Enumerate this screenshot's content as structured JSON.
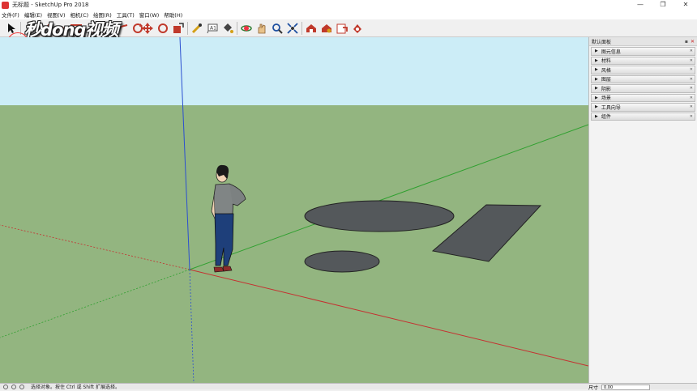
{
  "window": {
    "title": "无标题 - SketchUp Pro 2018",
    "controls": [
      "—",
      "❐",
      "✕"
    ]
  },
  "menu": [
    "文件(F)",
    "编辑(E)",
    "视图(V)",
    "相机(C)",
    "绘图(R)",
    "工具(T)",
    "窗口(W)",
    "帮助(H)"
  ],
  "toolbar": {
    "tools": [
      {
        "name": "select-tool-icon",
        "color": "#222222"
      },
      {
        "name": "eraser-tool-icon",
        "color": "#e85d8a"
      },
      {
        "name": "line-tool-icon",
        "color": "#c0392b"
      },
      {
        "name": "arc-tool-icon",
        "color": "#c0392b"
      },
      {
        "name": "rectangle-tool-icon",
        "color": "#c0392b"
      },
      {
        "name": "push-pull-tool-icon",
        "color": "#c0392b"
      },
      {
        "name": "move-tool-icon",
        "color": "#c0392b"
      },
      {
        "name": "rotate-tool-icon",
        "color": "#c0392b"
      },
      {
        "name": "scale-tool-icon",
        "color": "#c0392b"
      },
      {
        "name": "tape-measure-tool-icon",
        "color": "#d4a017"
      },
      {
        "name": "text-tool-icon",
        "color": "#555555"
      },
      {
        "name": "paint-bucket-tool-icon",
        "color": "#444444"
      },
      {
        "name": "orbit-tool-icon",
        "color": "#2e7d32"
      },
      {
        "name": "pan-tool-icon",
        "color": "#c48a3a"
      },
      {
        "name": "zoom-tool-icon",
        "color": "#1e4fa0"
      },
      {
        "name": "zoom-extents-tool-icon",
        "color": "#1e4fa0"
      },
      {
        "name": "warehouse-icon",
        "color": "#c0392b"
      },
      {
        "name": "extension-warehouse-icon",
        "color": "#c0392b"
      },
      {
        "name": "send-to-layout-icon",
        "color": "#c0392b"
      },
      {
        "name": "extension-manager-icon",
        "color": "#c0392b"
      }
    ]
  },
  "watermark": {
    "text": "秒dong视频"
  },
  "tray": {
    "title": "默认面板",
    "panels": [
      "图元信息",
      "材料",
      "风格",
      "图层",
      "阴影",
      "场景",
      "工具向导",
      "组件"
    ]
  },
  "status": {
    "hint": "选择对象。按住 Ctrl 或 Shift 扩展选择。",
    "measurement_label": "尺寸",
    "measurement_value": "0.00"
  },
  "colors": {
    "sky": "#ccedf7",
    "ground": "#93b580",
    "shape_fill": "#54585b",
    "red_axis": "#c53030",
    "green_axis": "#2fa02f",
    "blue_axis": "#2b4fd0"
  }
}
